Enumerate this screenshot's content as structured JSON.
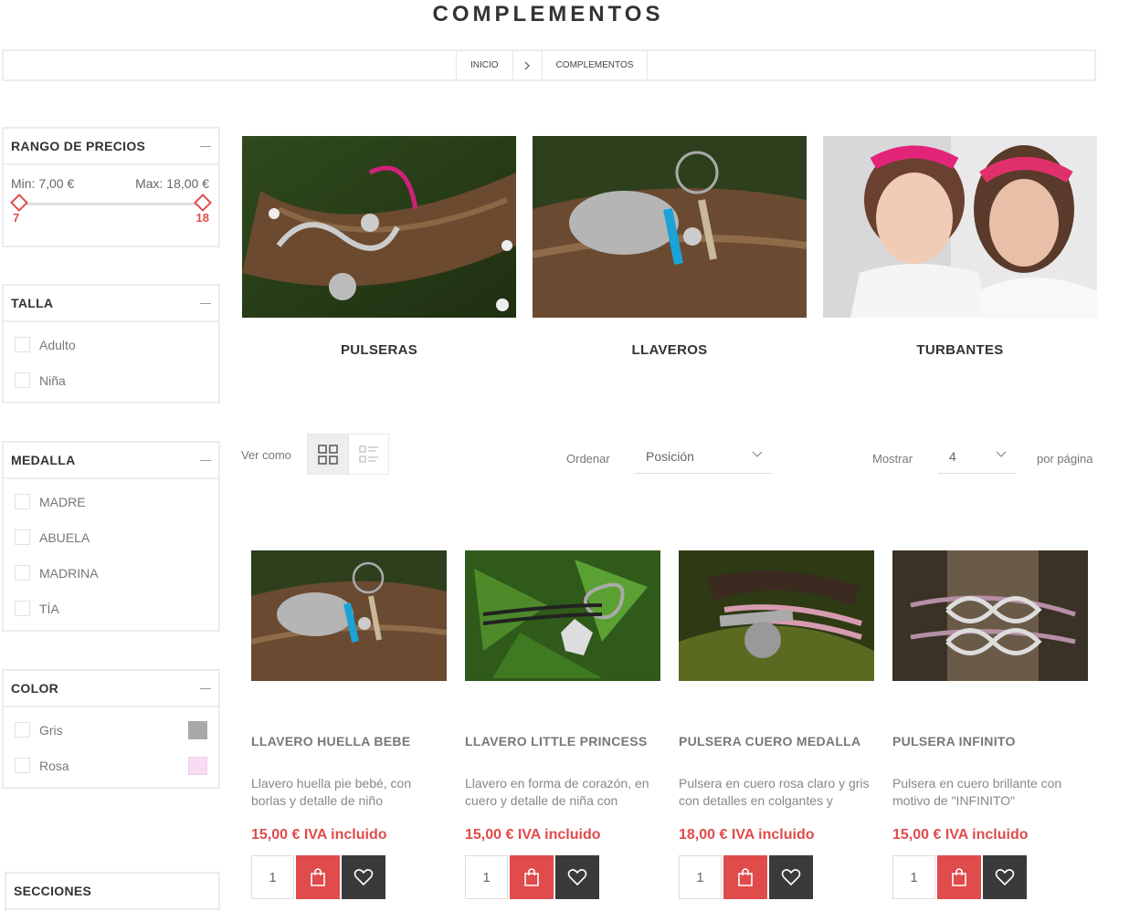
{
  "page": {
    "title": "COMPLEMENTOS"
  },
  "breadcrumb": {
    "home": "INICIO",
    "current": "COMPLEMENTOS"
  },
  "filters": {
    "price": {
      "title": "RANGO DE PRECIOS",
      "min_label": "Min: 7,00 €",
      "max_label": "Max: 18,00 €",
      "min_value": "7",
      "max_value": "18"
    },
    "talla": {
      "title": "TALLA",
      "options": [
        "Adulto",
        "Niña"
      ]
    },
    "medalla": {
      "title": "MEDALLA",
      "options": [
        "MADRE",
        "ABUELA",
        "MADRINA",
        "TÍA"
      ]
    },
    "color": {
      "title": "COLOR",
      "options": [
        {
          "label": "Gris",
          "swatch": "#a9a9a9"
        },
        {
          "label": "Rosa",
          "swatch": "#f7dcf4"
        }
      ]
    },
    "secciones": {
      "title": "SECCIONES"
    }
  },
  "categories": [
    {
      "name": "PULSERAS"
    },
    {
      "name": "LLAVEROS"
    },
    {
      "name": "TURBANTES"
    }
  ],
  "toolbar": {
    "view_label": "Ver como",
    "sort_label": "Ordenar",
    "sort_value": "Posición",
    "show_label": "Mostrar",
    "show_value": "4",
    "per_page_label": "por página"
  },
  "products": [
    {
      "name": "LLAVERO HUELLA BEBE",
      "desc": "Llavero huella pie bebé, con borlas y detalle de niño",
      "price": "15,00 € IVA incluido",
      "qty": "1"
    },
    {
      "name": "LLAVERO LITTLE PRINCESS",
      "desc": "Llavero en forma de corazón, en cuero y detalle de niña con",
      "price": "15,00 € IVA incluido",
      "qty": "1"
    },
    {
      "name": "PULSERA CUERO MEDALLA",
      "desc": "Pulsera en cuero rosa claro y gris con detalles en colgantes y",
      "price": "18,00 € IVA incluido",
      "qty": "1"
    },
    {
      "name": "PULSERA INFINITO",
      "desc": "Pulsera en cuero brillante con motivo de \"INFINITO\"",
      "price": "15,00 € IVA incluido",
      "qty": "1"
    }
  ],
  "colors": {
    "accent": "#e04b4b",
    "dark_button": "#3a3a3a"
  }
}
